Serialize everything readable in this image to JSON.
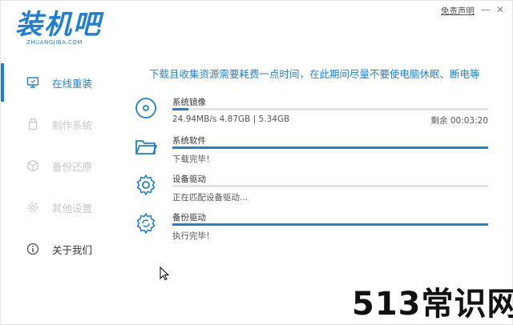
{
  "app": {
    "logo_text": "装机吧",
    "logo_sub": "ZHUANGJIBA.COM",
    "disclaimer": "免责声明",
    "minimize_glyph": "—",
    "close_glyph": "✕"
  },
  "sidebar": {
    "items": [
      {
        "label": "在线重装",
        "icon": "monitor-icon",
        "state": "active"
      },
      {
        "label": "制作系统",
        "icon": "usb-drive-icon",
        "state": "disabled"
      },
      {
        "label": "备份还原",
        "icon": "backup-box-icon",
        "state": "disabled"
      },
      {
        "label": "其他设置",
        "icon": "gear-icon",
        "state": "disabled"
      },
      {
        "label": "关于我们",
        "icon": "info-icon",
        "state": "normal"
      }
    ]
  },
  "main": {
    "notice": "下载且收集资源需要耗费一点时间，在此期间尽量不要使电脑休眠、断电等",
    "tasks": [
      {
        "name": "系统镜像",
        "icon": "disc-icon",
        "progress": 0.05,
        "status": "24.94MB/s 4.87GB | 5.34GB",
        "remaining": "剩余 00:03:20"
      },
      {
        "name": "系统软件",
        "icon": "folder-icon",
        "progress": 1.0,
        "status": "下载完毕！",
        "remaining": ""
      },
      {
        "name": "设备驱动",
        "icon": "gear-icon",
        "progress": 0.0,
        "status": "正在匹配设备驱动...",
        "remaining": ""
      },
      {
        "name": "备份驱动",
        "icon": "gear-refresh-icon",
        "progress": 1.0,
        "status": "执行完毕！",
        "remaining": ""
      }
    ]
  },
  "watermark": "513常识网",
  "colors": {
    "accent": "#1f7fd4",
    "track": "#e3e3e3",
    "disabled_text": "#c6c6c6"
  }
}
